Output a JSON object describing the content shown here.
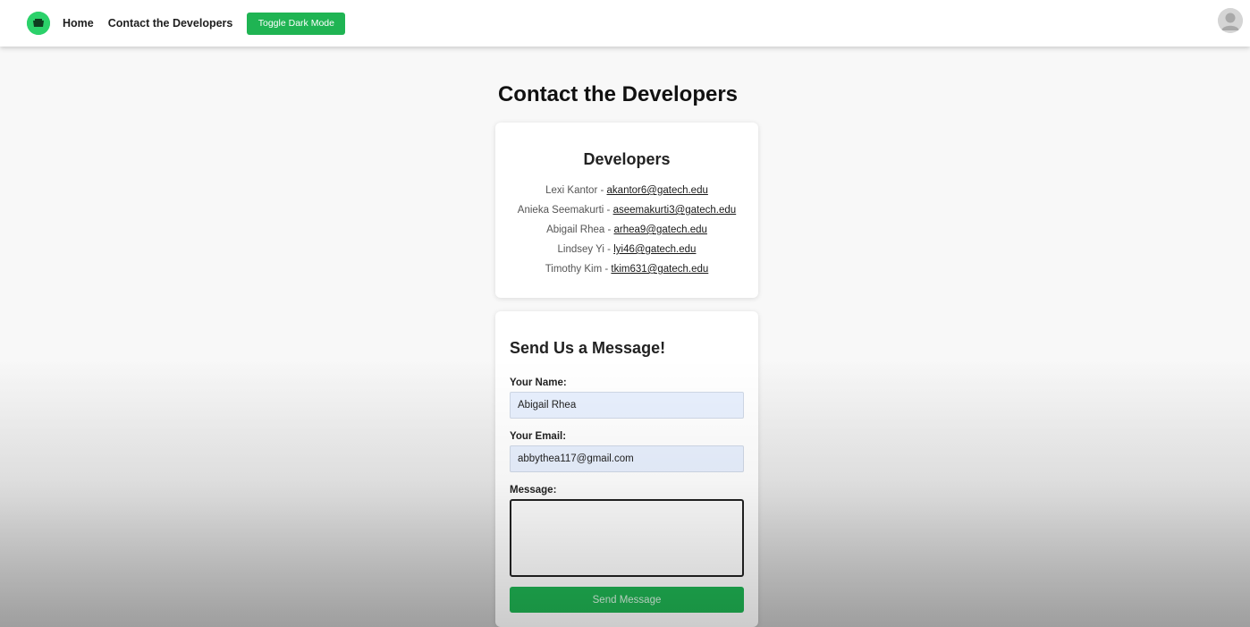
{
  "nav": {
    "home_label": "Home",
    "contact_label": "Contact the Developers",
    "toggle_label": "Toggle Dark Mode"
  },
  "page": {
    "title": "Contact the Developers"
  },
  "developers": {
    "heading": "Developers",
    "items": [
      {
        "name": "Lexi Kantor",
        "email": "akantor6@gatech.edu"
      },
      {
        "name": "Anieka Seemakurti",
        "email": "aseemakurti3@gatech.edu"
      },
      {
        "name": "Abigail Rhea",
        "email": "arhea9@gatech.edu"
      },
      {
        "name": "Lindsey Yi",
        "email": "lyi46@gatech.edu"
      },
      {
        "name": "Timothy Kim",
        "email": "tkim631@gatech.edu"
      }
    ]
  },
  "form": {
    "heading": "Send Us a Message!",
    "name_label": "Your Name:",
    "name_value": "Abigail Rhea",
    "email_label": "Your Email:",
    "email_value": "abbythea117@gmail.com",
    "message_label": "Message:",
    "message_value": "",
    "submit_label": "Send Message"
  },
  "colors": {
    "accent": "#1fb453",
    "logo": "#2bd16a",
    "input_bg": "#e8f0fe"
  },
  "icons": {
    "logo": "app-logo-icon",
    "avatar": "user-avatar-icon"
  }
}
